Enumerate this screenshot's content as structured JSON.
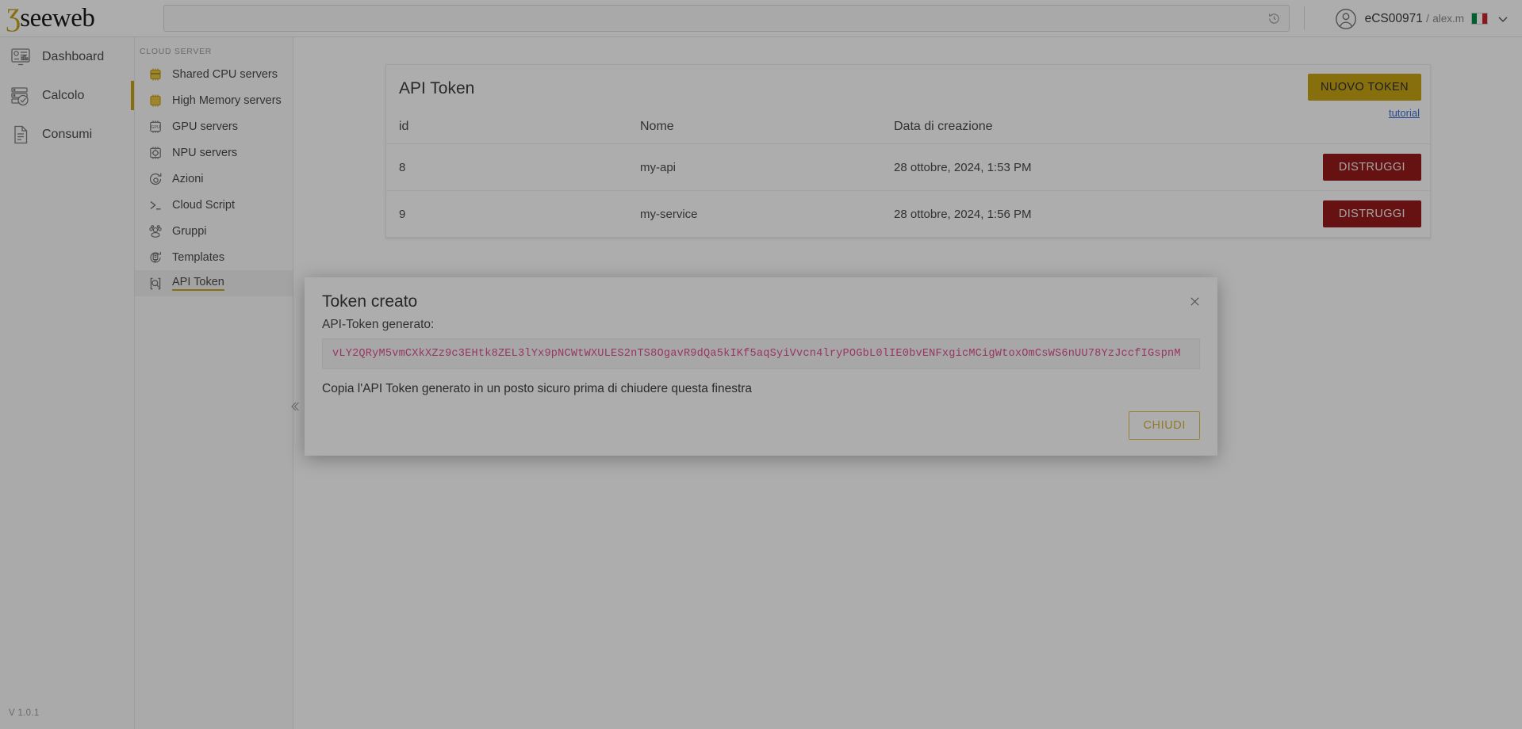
{
  "header": {
    "logo_text": "seeweb",
    "search_value": "",
    "search_placeholder": "",
    "search_icon": "history-icon",
    "user_account": "eCS00971",
    "user_separator": "/",
    "user_name": "alex.m",
    "avatar_icon": "user-avatar-icon",
    "flag_icon": "italy-flag-icon",
    "chevron_icon": "chevron-down-icon"
  },
  "sidebar": {
    "items": [
      {
        "label": "Dashboard",
        "icon": "dashboard-icon",
        "active": false
      },
      {
        "label": "Calcolo",
        "icon": "servers-icon",
        "active": true
      },
      {
        "label": "Consumi",
        "icon": "document-icon",
        "active": false
      }
    ],
    "version": "V 1.0.1"
  },
  "sidebar_secondary": {
    "title": "CLOUD SERVER",
    "items": [
      {
        "label": "Shared CPU servers",
        "icon": "cpu-chip-icon",
        "selected": false
      },
      {
        "label": "High Memory servers",
        "icon": "memory-chip-icon",
        "selected": false
      },
      {
        "label": "GPU servers",
        "icon": "gpu-chip-icon",
        "selected": false
      },
      {
        "label": "NPU servers",
        "icon": "npu-chip-icon",
        "selected": false
      },
      {
        "label": "Azioni",
        "icon": "actions-gear-icon",
        "selected": false
      },
      {
        "label": "Cloud Script",
        "icon": "terminal-prompt-icon",
        "selected": false
      },
      {
        "label": "Gruppi",
        "icon": "users-group-icon",
        "selected": false
      },
      {
        "label": "Templates",
        "icon": "template-icon",
        "selected": false
      },
      {
        "label": "API Token",
        "icon": "api-token-icon",
        "selected": true
      }
    ],
    "collapse_icon": "collapse-left-icon"
  },
  "main": {
    "card_title": "API Token",
    "new_token_button": "NUOVO TOKEN",
    "tutorial_link": "tutorial",
    "table": {
      "columns": [
        "id",
        "Nome",
        "Data di creazione",
        ""
      ],
      "rows": [
        {
          "id": "8",
          "nome": "my-api",
          "data": "28 ottobre, 2024, 1:53 PM",
          "action": "DISTRUGGI"
        },
        {
          "id": "9",
          "nome": "my-service",
          "data": "28 ottobre, 2024, 1:56 PM",
          "action": "DISTRUGGI"
        }
      ]
    }
  },
  "modal": {
    "title": "Token creato",
    "close_icon": "close-x-icon",
    "label": "API-Token generato:",
    "token": "vLY2QRyM5vmCXkXZz9c3EHtk8ZEL3lYx9pNCWtWXULES2nTS8OgavR9dQa5kIKf5aqSyiVvcn4lryPOGbL0lIE0bvENFxgicMCigWtoxOmCsWS6nUU78YzJccfIGspnM",
    "note": "Copia l'API Token generato in un posto sicuro prima di chiudere questa finestra",
    "close_button": "CHIUDI"
  },
  "colors": {
    "accent_gold": "#c8a415",
    "danger_red": "#991b1b",
    "token_pink": "#e0508f",
    "link_blue": "#3b6fd4"
  }
}
